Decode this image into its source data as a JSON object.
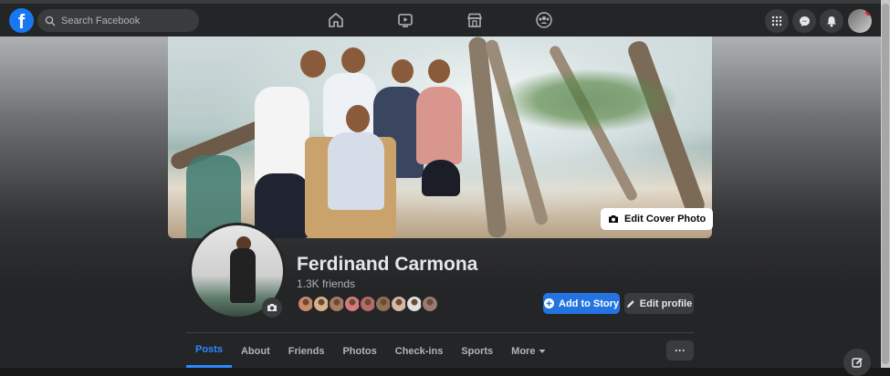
{
  "topbar": {
    "search_placeholder": "Search Facebook",
    "logo_letter": "f",
    "nav_icons": [
      "home-icon",
      "watch-icon",
      "marketplace-icon",
      "groups-icon"
    ],
    "right_icons": [
      "menu-grid-icon",
      "messenger-icon",
      "notifications-icon"
    ]
  },
  "cover": {
    "edit_label": "Edit Cover Photo"
  },
  "profile": {
    "name": "Ferdinand Carmona",
    "friends_count": "1.3K friends",
    "friend_avatar_colors": [
      "#c98a6a",
      "#d8b28c",
      "#a87b62",
      "#d47b7b",
      "#b56b6b",
      "#8f7055",
      "#d9b7a8",
      "#e0e0e0",
      "#9a7a72"
    ]
  },
  "actions": {
    "add_story": "Add to Story",
    "edit_profile": "Edit profile"
  },
  "tabs": [
    {
      "label": "Posts",
      "active": true
    },
    {
      "label": "About",
      "active": false
    },
    {
      "label": "Friends",
      "active": false
    },
    {
      "label": "Photos",
      "active": false
    },
    {
      "label": "Check-ins",
      "active": false
    },
    {
      "label": "Sports",
      "active": false
    },
    {
      "label": "More",
      "active": false
    }
  ],
  "more_dots": "···",
  "colors": {
    "accent": "#2374e1",
    "tab_active": "#2d88ff",
    "background": "#18191a",
    "surface": "#242526"
  }
}
